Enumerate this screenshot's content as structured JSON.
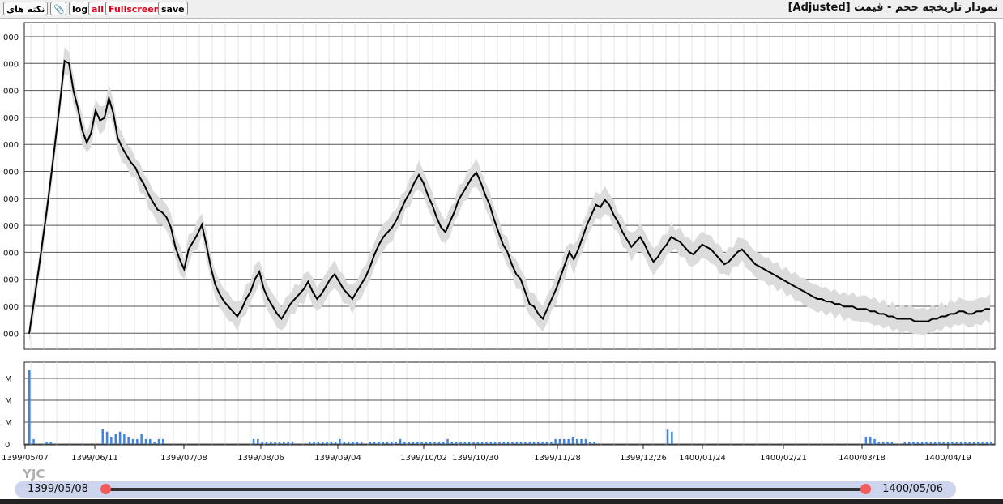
{
  "toolbar": {
    "notes_label": "نکته های",
    "log_label": "log",
    "all_label": "all",
    "fullscreen_label": "Fullscreen",
    "save_label": "save",
    "title": "نمودار تاریخچه حجم - قیمت [Adjusted]"
  },
  "price_axis_labels": [
    "000",
    "000",
    "000",
    "000",
    "000",
    "000",
    "000",
    "000",
    "000",
    "000",
    "000",
    "000"
  ],
  "volume_axis_labels": [
    "M",
    "M",
    "M",
    "0"
  ],
  "date_ticks": [
    "1399/05/07",
    "1399/06/11",
    "1399/07/08",
    "1399/08/06",
    "1399/09/04",
    "1399/10/02",
    "1399/10/30",
    "1399/11/28",
    "1399/12/26",
    "1400/01/24",
    "1400/02/21",
    "1400/03/18",
    "1400/04/19"
  ],
  "range": {
    "start": "1399/05/08",
    "end": "1400/05/06"
  },
  "watermark": "YJC",
  "colors": {
    "price_line": "#000000",
    "band": "#dcdcdc",
    "volume_bar": "#3d85e0",
    "grid": "#555555",
    "handle": "#f25c5c"
  },
  "chart_data": {
    "type": "line",
    "price_series": {
      "x_index": [
        0,
        1,
        2,
        3,
        4,
        5,
        6,
        7,
        8,
        9,
        10,
        11,
        12,
        13,
        14,
        15,
        16,
        17,
        18,
        19,
        20,
        21,
        22,
        23,
        24,
        25,
        26,
        27,
        28,
        29,
        30,
        31,
        32,
        33,
        34,
        35,
        36,
        37,
        38,
        39,
        40,
        41,
        42,
        43,
        44,
        45,
        46,
        47,
        48,
        49,
        50,
        51,
        52,
        53,
        54,
        55,
        56,
        57,
        58,
        59,
        60,
        61,
        62,
        63,
        64,
        65,
        66,
        67,
        68,
        69,
        70,
        71,
        72,
        73,
        74,
        75,
        76,
        77,
        78,
        79,
        80,
        81,
        82,
        83,
        84,
        85,
        86,
        87,
        88,
        89,
        90,
        91,
        92,
        93,
        94,
        95,
        96,
        97,
        98,
        99,
        100,
        101,
        102,
        103,
        104,
        105,
        106,
        107,
        108,
        109,
        110,
        111,
        112,
        113,
        114,
        115,
        116,
        117,
        118,
        119,
        120,
        121,
        122,
        123,
        124,
        125,
        126,
        127,
        128,
        129,
        130,
        131,
        132,
        133,
        134,
        135,
        136,
        137,
        138,
        139,
        140,
        141,
        142,
        143,
        144,
        145,
        146,
        147,
        148,
        149,
        150,
        151,
        152,
        153,
        154,
        155,
        156,
        157,
        158,
        159,
        160,
        161,
        162,
        163,
        164,
        165,
        166,
        167,
        168,
        169,
        170,
        171,
        172,
        173,
        174,
        175,
        176,
        177,
        178,
        179,
        180,
        181,
        182,
        183,
        184,
        185,
        186,
        187,
        188,
        189,
        190,
        191,
        192,
        193,
        194,
        195,
        196,
        197,
        198,
        199,
        200,
        201,
        202,
        203,
        204,
        205,
        206,
        207,
        208,
        209,
        210,
        211,
        212,
        213,
        214,
        215
      ],
      "values": [
        0.2,
        1.4,
        2.6,
        3.9,
        5.2,
        6.6,
        8.1,
        9.6,
        11.2,
        11.1,
        10.0,
        9.3,
        8.4,
        7.9,
        8.3,
        9.2,
        8.8,
        8.9,
        9.7,
        9.1,
        8.1,
        7.7,
        7.4,
        7.1,
        6.9,
        6.5,
        6.2,
        5.8,
        5.5,
        5.2,
        5.1,
        4.9,
        4.5,
        3.7,
        3.2,
        2.8,
        3.6,
        3.9,
        4.2,
        4.6,
        3.8,
        2.9,
        2.2,
        1.8,
        1.5,
        1.3,
        1.1,
        0.9,
        1.2,
        1.6,
        1.9,
        2.4,
        2.7,
        2.0,
        1.6,
        1.3,
        1.0,
        0.8,
        1.1,
        1.4,
        1.6,
        1.8,
        2.0,
        2.3,
        1.9,
        1.6,
        1.8,
        2.1,
        2.4,
        2.6,
        2.3,
        2.0,
        1.8,
        1.6,
        1.9,
        2.2,
        2.5,
        2.9,
        3.4,
        3.8,
        4.1,
        4.3,
        4.5,
        4.8,
        5.2,
        5.6,
        5.9,
        6.3,
        6.6,
        6.3,
        5.8,
        5.4,
        4.9,
        4.5,
        4.3,
        4.7,
        5.1,
        5.6,
        5.9,
        6.2,
        6.5,
        6.7,
        6.3,
        5.8,
        5.4,
        4.8,
        4.3,
        3.8,
        3.5,
        3.0,
        2.6,
        2.4,
        1.9,
        1.4,
        1.3,
        1.0,
        0.8,
        1.2,
        1.6,
        2.0,
        2.5,
        3.0,
        3.5,
        3.2,
        3.6,
        4.1,
        4.6,
        5.0,
        5.4,
        5.3,
        5.6,
        5.4,
        5.0,
        4.7,
        4.3,
        4.0,
        3.7,
        3.9,
        4.1,
        3.8,
        3.4,
        3.1,
        3.3,
        3.6,
        3.8,
        4.1,
        4.0,
        3.9,
        3.7,
        3.5,
        3.4,
        3.6,
        3.8,
        3.7,
        3.6,
        3.4,
        3.2,
        3.0,
        3.1,
        3.3,
        3.5,
        3.6,
        3.4,
        3.2,
        3.0,
        2.9,
        2.8,
        2.7,
        2.6,
        2.5,
        2.4,
        2.3,
        2.2,
        2.1,
        2.0,
        1.9,
        1.8,
        1.7,
        1.6,
        1.6,
        1.5,
        1.5,
        1.4,
        1.4,
        1.3,
        1.3,
        1.3,
        1.2,
        1.2,
        1.2,
        1.1,
        1.1,
        1.0,
        1.0,
        0.9,
        0.9,
        0.8,
        0.8,
        0.8,
        0.8,
        0.7,
        0.7,
        0.7,
        0.7,
        0.8,
        0.8,
        0.9,
        0.9,
        1.0,
        1.0,
        1.1,
        1.1,
        1.0,
        1.0,
        1.1,
        1.1,
        1.2,
        1.2
      ]
    },
    "volume_series": {
      "values": [
        30,
        2,
        0,
        0,
        1,
        1,
        0,
        0,
        0,
        0,
        0,
        0,
        0,
        0,
        0,
        0,
        0,
        6,
        5,
        3,
        4,
        5,
        4,
        3,
        2,
        2,
        4,
        2,
        2,
        1,
        2,
        2,
        0,
        0,
        0,
        0,
        0,
        0,
        0,
        0,
        0,
        0,
        0,
        0,
        0,
        0,
        0,
        0,
        0,
        0,
        0,
        0,
        2,
        2,
        1,
        1,
        1,
        1,
        1,
        1,
        1,
        1,
        0,
        0,
        0,
        1,
        1,
        1,
        1,
        1,
        1,
        1,
        2,
        1,
        1,
        1,
        1,
        1,
        0,
        1,
        1,
        1,
        1,
        1,
        1,
        1,
        2,
        1,
        1,
        1,
        1,
        1,
        1,
        1,
        1,
        1,
        1,
        2,
        1,
        1,
        1,
        1,
        1,
        1,
        1,
        1,
        1,
        1,
        1,
        1,
        1,
        1,
        1,
        1,
        1,
        1,
        1,
        1,
        1,
        1,
        1,
        1,
        2,
        2,
        2,
        2,
        3,
        2,
        2,
        2,
        1,
        1,
        0,
        0,
        0,
        0,
        0,
        0,
        0,
        0,
        0,
        0,
        0,
        0,
        0,
        0,
        0,
        0,
        6,
        5,
        0,
        0,
        0,
        0,
        0,
        0,
        0,
        0,
        0,
        0,
        0,
        0,
        0,
        0,
        0,
        0,
        0,
        0,
        0,
        0,
        0,
        0,
        0,
        0,
        0,
        0,
        0,
        0,
        0,
        0,
        0,
        0,
        0,
        0,
        0,
        0,
        0,
        0,
        0,
        0,
        0,
        0,
        0,
        0,
        3,
        3,
        2,
        1,
        1,
        1,
        1,
        0,
        0,
        1,
        1,
        1,
        1,
        1,
        1,
        1,
        1,
        1,
        1,
        1,
        1,
        1,
        1,
        1,
        1,
        1,
        1,
        1,
        1,
        1
      ]
    }
  }
}
